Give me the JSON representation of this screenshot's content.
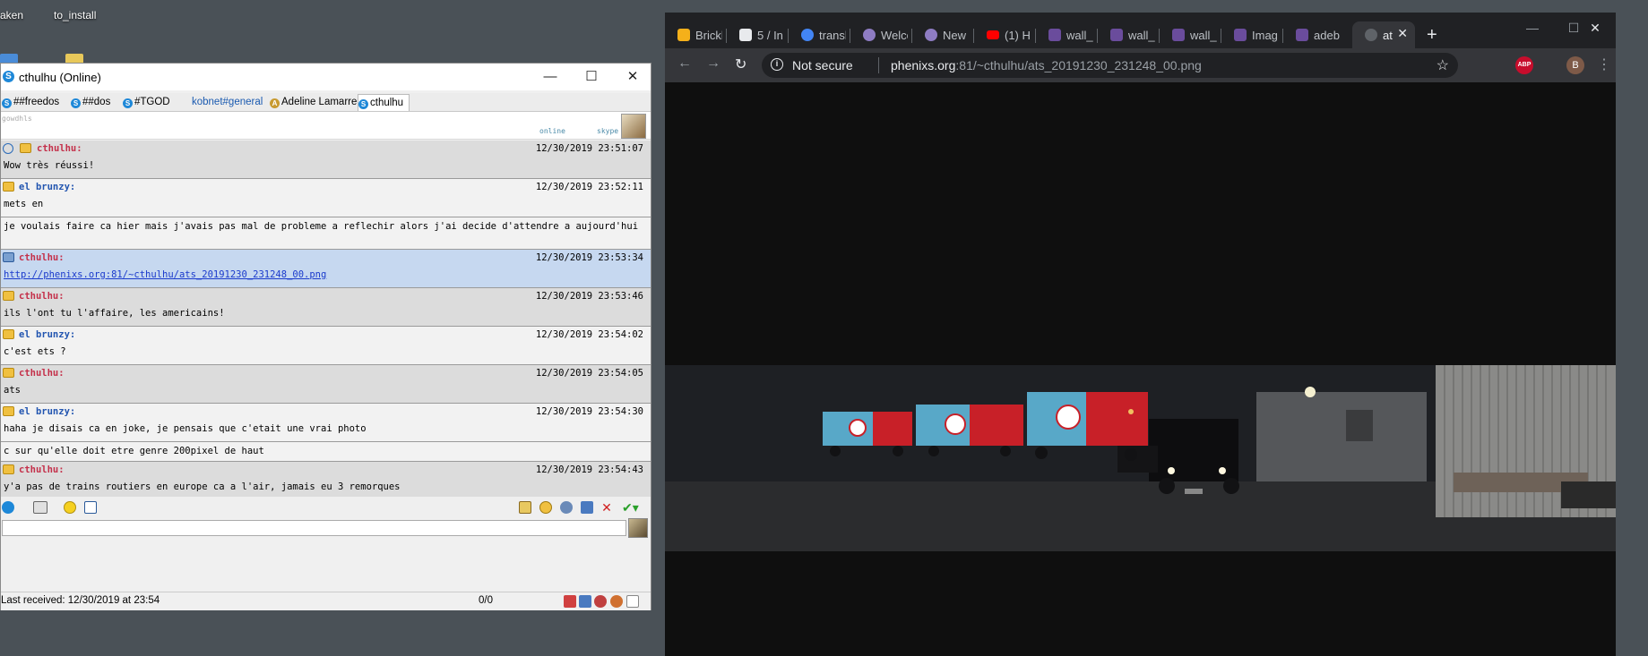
{
  "desktop": {
    "icons": [
      {
        "label": "aken",
        "icon": "folder-icon"
      },
      {
        "label": "to_install",
        "icon": "folder-icon"
      }
    ]
  },
  "chat": {
    "title": "cthulhu (Online)",
    "window_controls": {
      "minimize": "—",
      "maximize": "☐",
      "close": "✕"
    },
    "tabs": [
      {
        "label": "##freedos",
        "active": false
      },
      {
        "label": "##dos",
        "active": false
      },
      {
        "label": "#TGOD",
        "active": false
      },
      {
        "label": "kobnet#general",
        "active": false
      },
      {
        "label": "Adeline Lamarre",
        "active": false
      },
      {
        "label": "cthulhu",
        "active": true
      }
    ],
    "header": {
      "mood": "gowdhls",
      "status": "online",
      "network": "skype"
    },
    "messages": [
      {
        "sender": "cthulhu:",
        "time": "12/30/2019 23:51:07",
        "lines": [
          "Wow très réussi!"
        ],
        "style": "grey",
        "color": "cth"
      },
      {
        "sender": "el brunzy:",
        "time": "12/30/2019 23:52:11",
        "lines": [
          "mets en"
        ],
        "style": "light",
        "color": "bru"
      },
      {
        "sender": "",
        "time": "",
        "lines": [
          "je voulais faire ca hier mais j'avais pas mal de probleme a reflechir alors j'ai decide d'attendre a aujourd'hui"
        ],
        "style": "light",
        "color": "bru"
      },
      {
        "sender": "cthulhu:",
        "time": "12/30/2019 23:53:34",
        "lines": [
          "http://phenixs.org:81/~cthulhu/ats_20191230_231248_00.png"
        ],
        "style": "blue",
        "color": "cth",
        "link": true
      },
      {
        "sender": "cthulhu:",
        "time": "12/30/2019 23:53:46",
        "lines": [
          "ils l'ont tu l'affaire, les americains!"
        ],
        "style": "grey",
        "color": "cth"
      },
      {
        "sender": "el brunzy:",
        "time": "12/30/2019 23:54:02",
        "lines": [
          "c'est ets ?"
        ],
        "style": "light",
        "color": "bru"
      },
      {
        "sender": "cthulhu:",
        "time": "12/30/2019 23:54:05",
        "lines": [
          "ats"
        ],
        "style": "grey",
        "color": "cth"
      },
      {
        "sender": "el brunzy:",
        "time": "12/30/2019 23:54:30",
        "lines": [
          "haha je disais ca en joke, je pensais que c'etait une vrai photo"
        ],
        "style": "light",
        "color": "bru"
      },
      {
        "sender": "",
        "time": "",
        "lines": [
          "c sur qu'elle doit etre genre 200pixel de haut"
        ],
        "style": "light",
        "color": "bru"
      },
      {
        "sender": "cthulhu:",
        "time": "12/30/2019 23:54:43",
        "lines": [
          "y'a pas de trains routiers en europe ca a l'air, jamais eu 3 remorques"
        ],
        "style": "grey",
        "color": "cth"
      }
    ],
    "status_bar": {
      "last_received": "Last received: 12/30/2019 at 23:54",
      "counter": "0/0"
    }
  },
  "browser": {
    "tabs": [
      {
        "label": "Brickl",
        "icon": "hexagon-icon",
        "color": "#f5b01a"
      },
      {
        "label": "5 / In",
        "icon": "page-icon",
        "color": "#e8eaed"
      },
      {
        "label": "transl",
        "icon": "google-icon",
        "color": "#4285f4"
      },
      {
        "label": "Welco",
        "icon": "d-logo-icon",
        "color": "#8e7cc3"
      },
      {
        "label": "New",
        "icon": "d-logo-icon",
        "color": "#8e7cc3"
      },
      {
        "label": "(1) H",
        "icon": "youtube-icon",
        "color": "#ff0000"
      },
      {
        "label": "wall_",
        "icon": "image-icon",
        "color": "#6a4c9c"
      },
      {
        "label": "wall_",
        "icon": "image-icon",
        "color": "#6a4c9c"
      },
      {
        "label": "wall_",
        "icon": "image-icon",
        "color": "#6a4c9c"
      },
      {
        "label": "Imag",
        "icon": "image-icon",
        "color": "#6a4c9c"
      },
      {
        "label": "adeb",
        "icon": "image-icon",
        "color": "#6a4c9c"
      },
      {
        "label": "at",
        "icon": "globe-icon",
        "color": "#9aa0a6",
        "active": true
      }
    ],
    "new_tab": "+",
    "window_controls": {
      "minimize": "—",
      "maximize": "☐",
      "close": "✕"
    },
    "security_label": "Not secure",
    "url_host": "phenixs.org",
    "url_rest": ":81/~cthulhu/ats_20191230_231248_00.png",
    "abp_label": "ABP",
    "profile_initial": "B"
  }
}
